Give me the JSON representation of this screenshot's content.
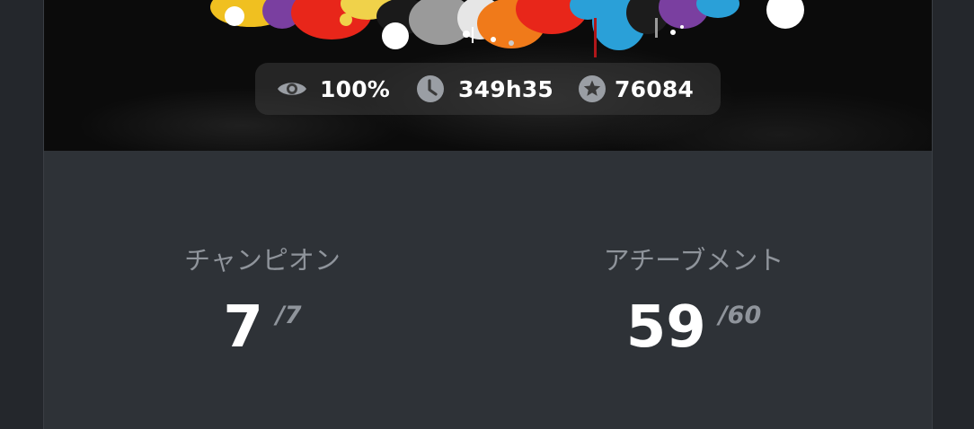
{
  "banner": {
    "stats": {
      "completion": "100%",
      "playtime": "349h35",
      "score": "76084"
    }
  },
  "summary": {
    "champions": {
      "label": "チャンピオン",
      "value": "7",
      "total": "/7"
    },
    "achievements": {
      "label": "アチーブメント",
      "value": "59",
      "total": "/60"
    }
  },
  "colors": {
    "page_background": "#24272c",
    "card_background": "#2e3237",
    "label_gray": "#8f949b",
    "value_white": "#ffffff"
  }
}
